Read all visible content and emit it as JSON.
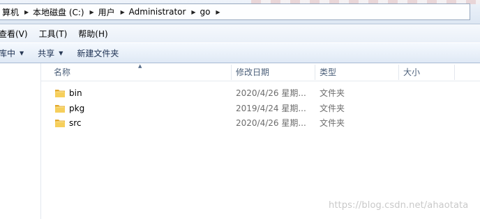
{
  "address_bar": {
    "crumbs": [
      "算机",
      "本地磁盘 (C:)",
      "用户",
      "Administrator",
      "go"
    ]
  },
  "menu": {
    "items": [
      "查看(V)",
      "工具(T)",
      "帮助(H)"
    ]
  },
  "toolbar": {
    "organize": "库中",
    "share": "共享",
    "new_folder": "新建文件夹"
  },
  "columns": {
    "name": "名称",
    "modified": "修改日期",
    "type": "类型",
    "size": "大小"
  },
  "files": [
    {
      "name": "bin",
      "modified": "2020/4/26 星期...",
      "type": "文件夹",
      "icon": "folder-icon"
    },
    {
      "name": "pkg",
      "modified": "2019/4/24 星期...",
      "type": "文件夹",
      "icon": "folder-icon"
    },
    {
      "name": "src",
      "modified": "2020/4/26 星期...",
      "type": "文件夹",
      "icon": "folder-icon"
    }
  ],
  "watermark": "https://blog.csdn.net/ahaotata",
  "colors": {
    "folder_yellow": "#f3c14a",
    "header_text": "#4c607a",
    "toolbar_text": "#1c3052"
  }
}
